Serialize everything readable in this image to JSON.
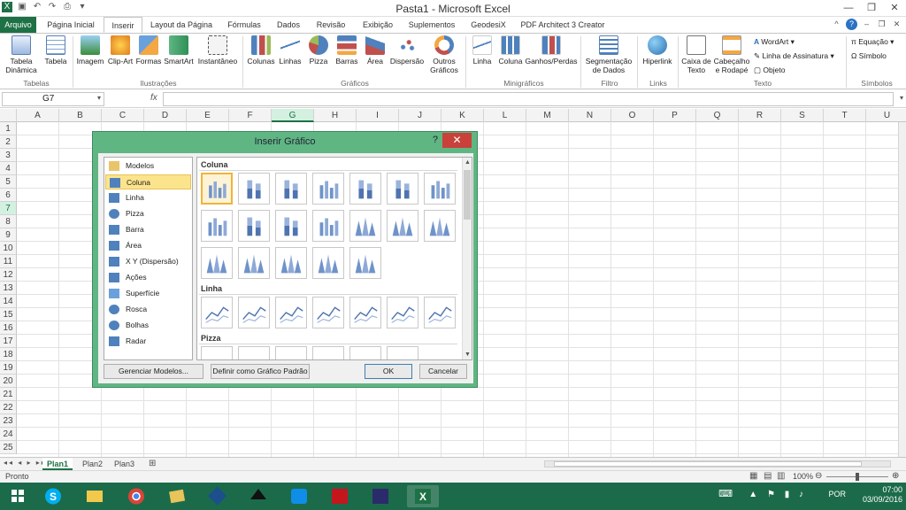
{
  "window": {
    "title": "Pasta1 - Microsoft Excel"
  },
  "tabs": [
    "Arquivo",
    "Página Inicial",
    "Inserir",
    "Layout da Página",
    "Fórmulas",
    "Dados",
    "Revisão",
    "Exibição",
    "Suplementos",
    "GeodesiX",
    "PDF Architect 3 Creator"
  ],
  "ribbon": {
    "tabela_dinamica": "Tabela Dinâmica",
    "tabela": "Tabela",
    "imagem": "Imagem",
    "clipart": "Clip-Art",
    "formas": "Formas",
    "smartart": "SmartArt",
    "instantaneo": "Instantâneo",
    "colunas": "Colunas",
    "linhas": "Linhas",
    "pizza": "Pizza",
    "barras": "Barras",
    "area": "Área",
    "dispersao": "Dispersão",
    "outros": "Outros Gráficos",
    "mini_linha": "Linha",
    "mini_coluna": "Coluna",
    "mini_ganhos": "Ganhos/Perdas",
    "segmentacao": "Segmentação de Dados",
    "hiperlink": "Hiperlink",
    "caixa_texto": "Caixa de Texto",
    "cabecalho": "Cabeçalho e Rodapé",
    "wordart": "WordArt",
    "linha_assinatura": "Linha de Assinatura",
    "objeto": "Objeto",
    "equacao": "Equação",
    "simbolo": "Símbolo",
    "groups": {
      "tabelas": "Tabelas",
      "ilustracoes": "Ilustrações",
      "graficos": "Gráficos",
      "minigraficos": "Minigráficos",
      "filtro": "Filtro",
      "links": "Links",
      "texto": "Texto",
      "simbolos": "Símbolos"
    }
  },
  "formula_bar": {
    "name_box": "G7",
    "fx": "fx",
    "value": ""
  },
  "columns": [
    "A",
    "B",
    "C",
    "D",
    "E",
    "F",
    "G",
    "H",
    "I",
    "J",
    "K",
    "L",
    "M",
    "N",
    "O",
    "P",
    "Q",
    "R",
    "S",
    "T",
    "U"
  ],
  "rows": [
    "1",
    "2",
    "3",
    "4",
    "5",
    "6",
    "7",
    "8",
    "9",
    "10",
    "11",
    "12",
    "13",
    "14",
    "15",
    "16",
    "17",
    "18",
    "19",
    "20",
    "21",
    "22",
    "23",
    "24",
    "25"
  ],
  "selected_cell": {
    "col": "G",
    "row": "7"
  },
  "sheets": [
    "Plan1",
    "Plan2",
    "Plan3"
  ],
  "status": {
    "ready": "Pronto",
    "zoom": "100%"
  },
  "tray": {
    "lang": "POR",
    "time": "07:00",
    "date": "03/09/2016"
  },
  "dialog": {
    "title": "Inserir Gráfico",
    "help": "?",
    "close": "✕",
    "types": [
      {
        "label": "Modelos",
        "icon": "folder-icon"
      },
      {
        "label": "Coluna",
        "icon": "column-chart-icon",
        "selected": true
      },
      {
        "label": "Linha",
        "icon": "line-chart-icon"
      },
      {
        "label": "Pizza",
        "icon": "pie-chart-icon"
      },
      {
        "label": "Barra",
        "icon": "bar-chart-icon"
      },
      {
        "label": "Área",
        "icon": "area-chart-icon"
      },
      {
        "label": "X Y (Dispersão)",
        "icon": "scatter-chart-icon"
      },
      {
        "label": "Ações",
        "icon": "stock-chart-icon"
      },
      {
        "label": "Superfície",
        "icon": "surface-chart-icon"
      },
      {
        "label": "Rosca",
        "icon": "doughnut-chart-icon"
      },
      {
        "label": "Bolhas",
        "icon": "bubble-chart-icon"
      },
      {
        "label": "Radar",
        "icon": "radar-chart-icon"
      }
    ],
    "sections": {
      "coluna": "Coluna",
      "linha": "Linha",
      "pizza": "Pizza"
    },
    "buttons": {
      "manage": "Gerenciar Modelos...",
      "default": "Definir como Gráfico Padrão",
      "ok": "OK",
      "cancel": "Cancelar"
    }
  }
}
